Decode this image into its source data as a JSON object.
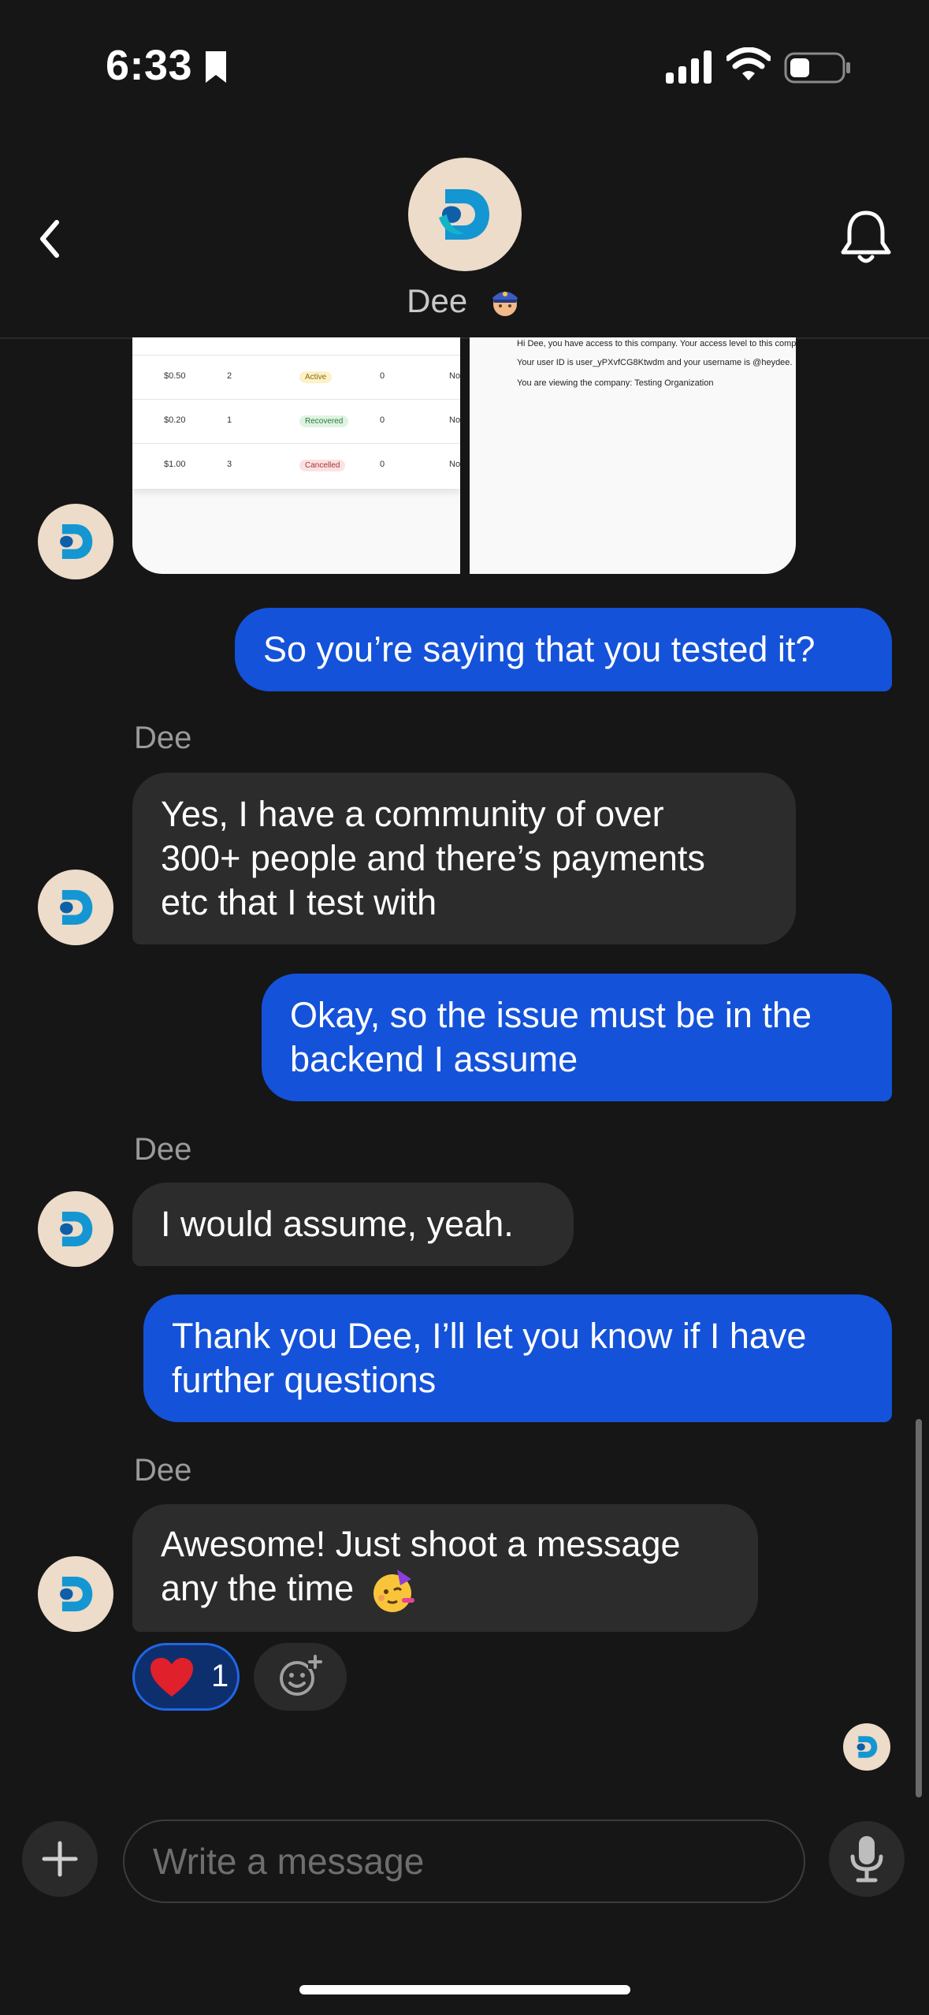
{
  "status_bar": {
    "time": "6:33"
  },
  "header": {
    "contact_name": "Dee"
  },
  "attachments": {
    "table_rows": [
      {
        "amount": "$0.50",
        "qty": "2",
        "status": "Active",
        "count": "0",
        "extra": "No"
      },
      {
        "amount": "$0.20",
        "qty": "1",
        "status": "Recovered",
        "count": "0",
        "extra": "No"
      },
      {
        "amount": "$1.00",
        "qty": "3",
        "status": "Cancelled",
        "count": "0",
        "extra": "No"
      }
    ],
    "info_lines": [
      "Hi Dee, you have access to this company. Your access level to this company",
      "Your user ID is user_yPXvfCG8Ktwdm and your username is @heydee.",
      "You are viewing the company: Testing Organization"
    ]
  },
  "messages": [
    {
      "text": "So you’re saying that you tested it?"
    },
    {
      "sender": "Dee",
      "lines": [
        "Yes, I have a community of over",
        "300+ people and there’s payments",
        "etc that I test with"
      ]
    },
    {
      "lines": [
        "Okay, so the issue must be in the",
        "backend I assume"
      ]
    },
    {
      "sender": "Dee",
      "text": "I would assume, yeah."
    },
    {
      "lines": [
        "Thank you Dee, I’ll let you know if I have",
        "further questions"
      ]
    },
    {
      "sender": "Dee",
      "lines": [
        "Awesome! Just shoot a message",
        "any the time"
      ],
      "emoji": "partying-face-icon"
    }
  ],
  "reaction": {
    "emoji": "red-heart",
    "count": "1"
  },
  "composer": {
    "placeholder": "Write a message"
  },
  "colors": {
    "outgoing": "#1452d9",
    "incoming": "#2c2c2c",
    "background": "#161616"
  }
}
